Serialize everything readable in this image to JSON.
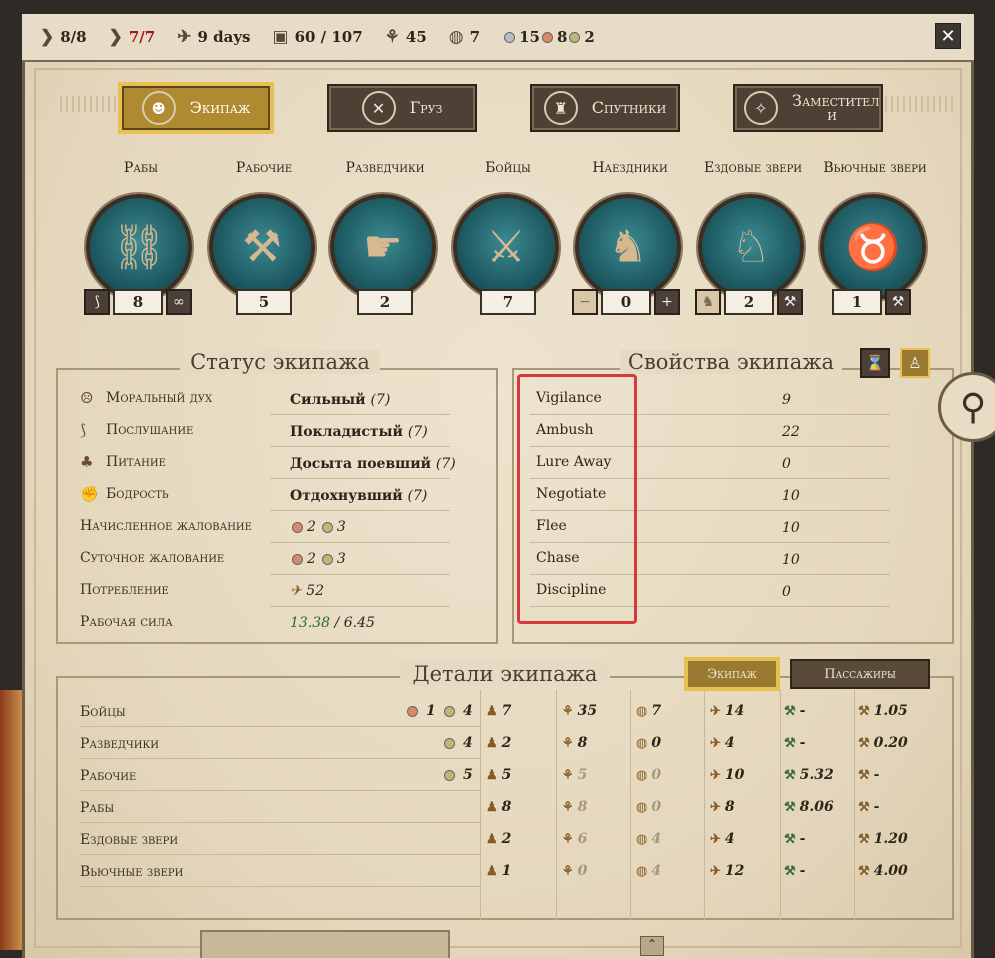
{
  "topbar": {
    "stats": [
      {
        "icon": "boot-icon",
        "value": "8/8"
      },
      {
        "icon": "red-boot-icon",
        "value": "7/7"
      },
      {
        "icon": "walking-man-icon",
        "value": "9 days"
      },
      {
        "icon": "crate-icon",
        "value": "60 / 107"
      },
      {
        "icon": "wheat-icon",
        "value": "45"
      },
      {
        "icon": "shield-icon",
        "value": "7"
      }
    ],
    "coins": [
      {
        "color": "#b8bcc4",
        "value": "15"
      },
      {
        "color": "#d88a6a",
        "value": "8"
      },
      {
        "color": "#b8b878",
        "value": "2"
      }
    ],
    "close_label": "✕"
  },
  "tabs": [
    {
      "label": "Экипаж",
      "icon": "people-icon",
      "active": true
    },
    {
      "label": "Груз",
      "icon": "cargo-icon",
      "active": false
    },
    {
      "label": "Спутники",
      "icon": "helmet-icon",
      "active": false
    },
    {
      "label": "Заместител и",
      "icon": "compass-icon",
      "active": false
    }
  ],
  "units": [
    {
      "label": "Рабы",
      "count": "8",
      "left_btn": "whip-icon",
      "right_btn": "chain-icon",
      "glyph": "⛓"
    },
    {
      "label": "Рабочие",
      "count": "5",
      "glyph": "⚒"
    },
    {
      "label": "Разведчики",
      "count": "2",
      "glyph": "☛"
    },
    {
      "label": "Бойцы",
      "count": "7",
      "glyph": "⚔"
    },
    {
      "label": "Наездники",
      "count": "0",
      "left_btn": "−",
      "right_btn": "+",
      "glyph": "♞"
    },
    {
      "label": "Ездовые звери",
      "count": "2",
      "left_btn": "camel-icon",
      "right_btn": "cleaver-icon",
      "glyph": "♘"
    },
    {
      "label": "Вьючные звери",
      "count": "1",
      "right_btn": "cleaver-icon",
      "glyph": "♉"
    }
  ],
  "status": {
    "title": "Статус экипажа",
    "rows": [
      {
        "label": "Моральный дух",
        "icon": "mask-icon",
        "value": "Сильный",
        "num": "(7)"
      },
      {
        "label": "Послушание",
        "icon": "whip-icon",
        "value": "Покладистый",
        "num": "(7)"
      },
      {
        "label": "Питание",
        "icon": "food-icon",
        "value": "Досыта поевший",
        "num": "(7)"
      },
      {
        "label": "Бодрость",
        "icon": "fist-icon",
        "value": "Отдохнувший",
        "num": "(7)"
      }
    ],
    "accrued_wage": {
      "label": "Начисленное жалование",
      "a": "2",
      "b": "3"
    },
    "daily_wage": {
      "label": "Суточное жалование",
      "a": "2",
      "b": "3"
    },
    "consumption": {
      "label": "Потребление",
      "value": "52"
    },
    "workforce": {
      "label": "Рабочая сила",
      "have": "13.38",
      "sep": " / ",
      "need": "6.45"
    }
  },
  "properties": {
    "title": "Свойства экипажа",
    "rows": [
      {
        "label": "Vigilance",
        "value": "9"
      },
      {
        "label": "Ambush",
        "value": "22"
      },
      {
        "label": "Lure Away",
        "value": "0"
      },
      {
        "label": "Negotiate",
        "value": "10"
      },
      {
        "label": "Flee",
        "value": "10"
      },
      {
        "label": "Chase",
        "value": "10"
      },
      {
        "label": "Discipline",
        "value": "0"
      }
    ]
  },
  "details": {
    "title": "Детали экипажа",
    "tab_crew": "Экипаж",
    "tab_passengers": "Пассажиры",
    "rows": [
      {
        "label": "Бойцы",
        "coinA": "1",
        "coinB": "4",
        "men": "7",
        "food": "35",
        "shield": "7",
        "speed": "14",
        "work": "-",
        "carry": "1.05",
        "dim": [
          false,
          false,
          false,
          false
        ]
      },
      {
        "label": "Разведчики",
        "coinA": "",
        "coinB": "4",
        "men": "2",
        "food": "8",
        "shield": "0",
        "speed": "4",
        "work": "-",
        "carry": "0.20",
        "dim": [
          false,
          false,
          false,
          false
        ]
      },
      {
        "label": "Рабочие",
        "coinA": "",
        "coinB": "5",
        "men": "5",
        "food": "5",
        "shield": "0",
        "speed": "10",
        "work": "5.32",
        "carry": "-",
        "dim": [
          true,
          true,
          false,
          false
        ]
      },
      {
        "label": "Рабы",
        "coinA": "",
        "coinB": "",
        "men": "8",
        "food": "8",
        "shield": "0",
        "speed": "8",
        "work": "8.06",
        "carry": "-",
        "dim": [
          true,
          true,
          false,
          false
        ]
      },
      {
        "label": "Ездовые звери",
        "coinA": "",
        "coinB": "",
        "men": "2",
        "food": "6",
        "shield": "4",
        "speed": "4",
        "work": "-",
        "carry": "1.20",
        "dim": [
          true,
          true,
          false,
          false
        ]
      },
      {
        "label": "Вьючные звери",
        "coinA": "",
        "coinB": "",
        "men": "1",
        "food": "0",
        "shield": "4",
        "speed": "12",
        "work": "-",
        "carry": "4.00",
        "dim": [
          true,
          true,
          false,
          false
        ]
      }
    ]
  },
  "colors": {
    "accent_gold": "#e8c050",
    "highlight_red": "#d63a3a",
    "parchment": "#e8dcc4"
  }
}
